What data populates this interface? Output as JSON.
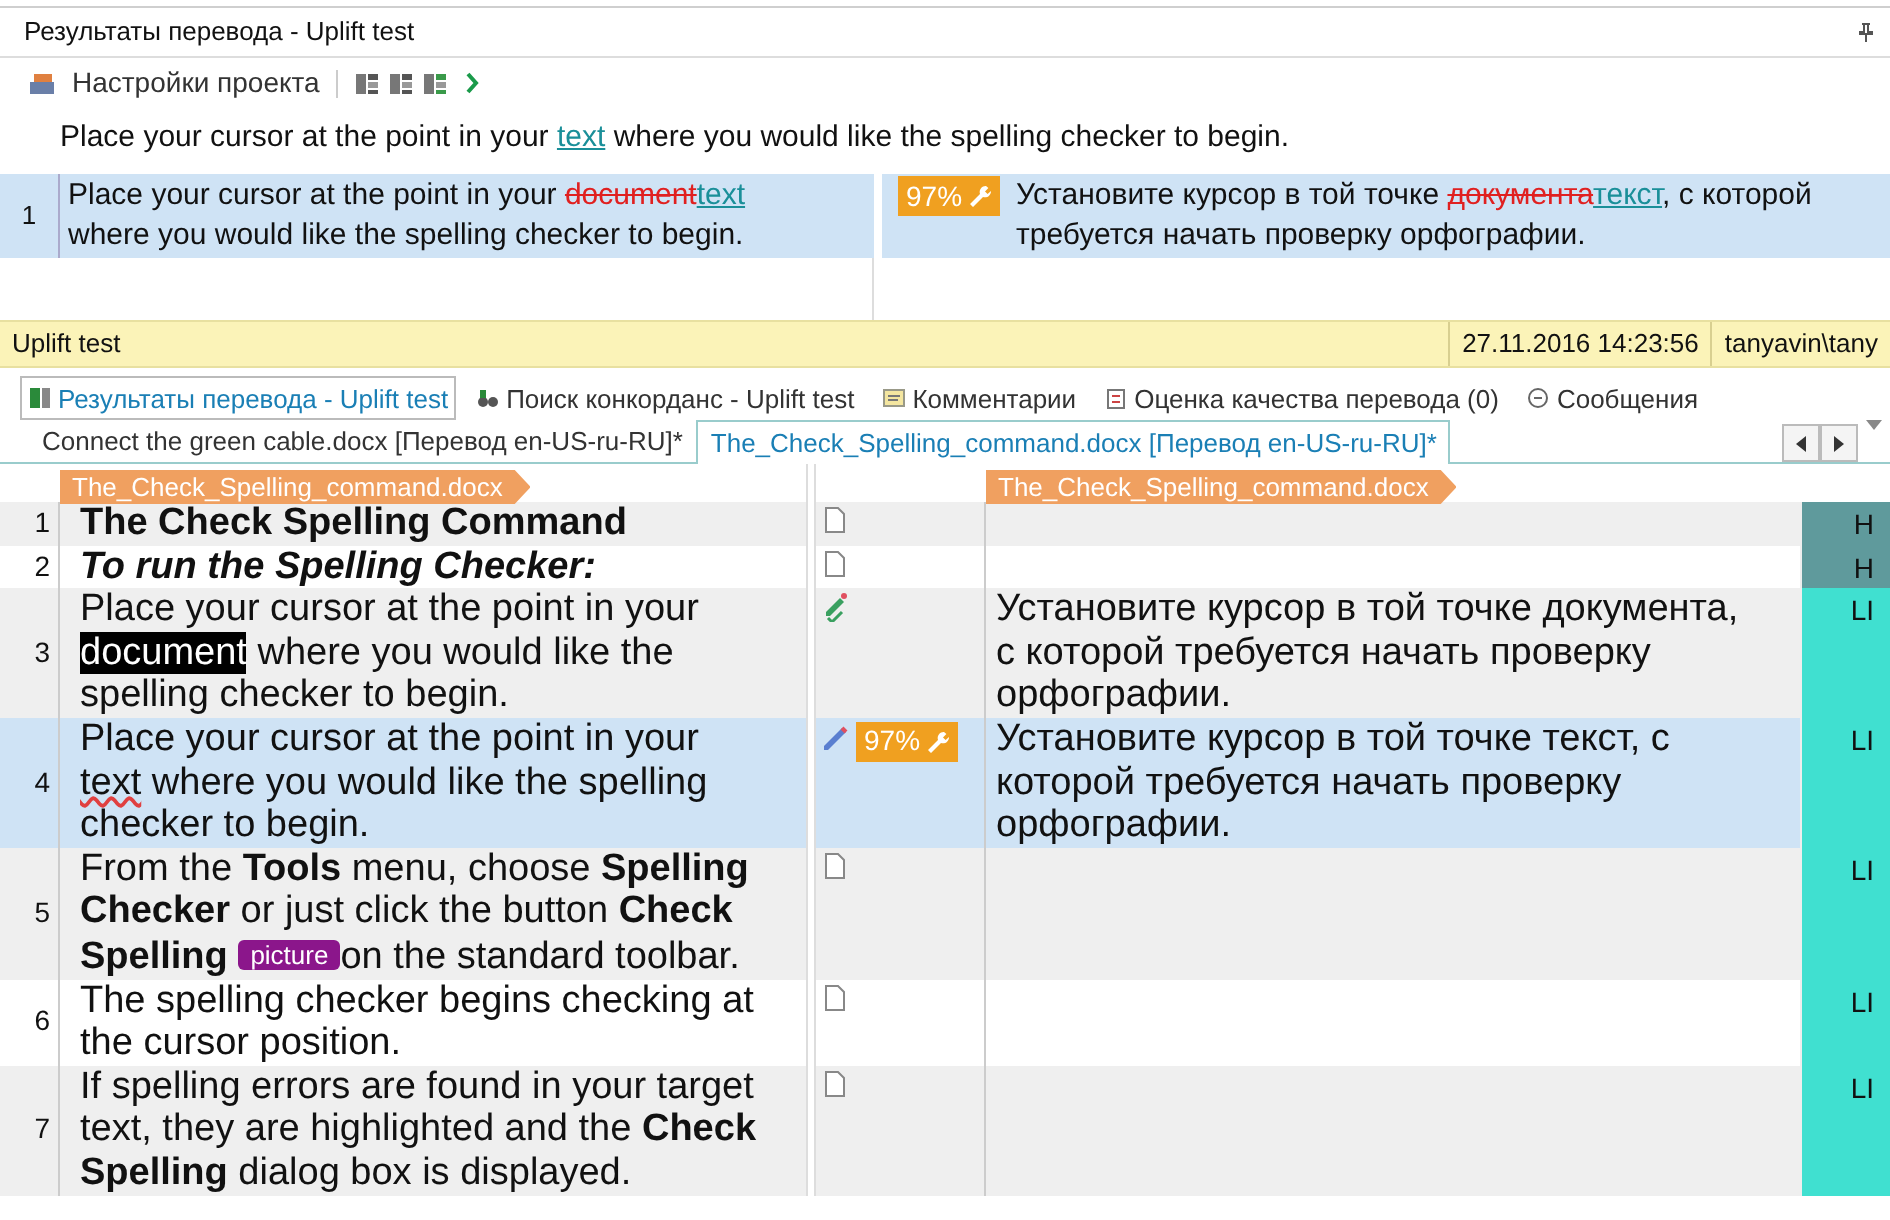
{
  "panel": {
    "title": "Результаты перевода - Uplift test"
  },
  "toolbar": {
    "settings_label": "Настройки проекта"
  },
  "preview": [
    {
      "kind": "plain",
      "text": "Place your cursor at the point in your "
    },
    {
      "kind": "inserted",
      "text": "text"
    },
    {
      "kind": "plain",
      "text": " where you would like the spelling checker to begin."
    }
  ],
  "match": {
    "number": "1",
    "score": "97%",
    "source": [
      {
        "kind": "plain",
        "text": "Place your cursor at the point in your "
      },
      {
        "kind": "deleted",
        "text": "document"
      },
      {
        "kind": "inserted",
        "text": "text"
      },
      {
        "kind": "plain",
        "text": " where you would like the spelling checker to begin."
      }
    ],
    "target": [
      {
        "kind": "plain",
        "text": "Установите курсор в той точке "
      },
      {
        "kind": "deleted",
        "text": "документа"
      },
      {
        "kind": "inserted",
        "text": "текст"
      },
      {
        "kind": "plain",
        "text": ", с которой требуется начать проверку орфографии."
      }
    ]
  },
  "status_bar": {
    "project": "Uplift test",
    "date": "27.11.2016 14:23:56",
    "user": "tanyavin\\tany"
  },
  "panel_tabs": [
    {
      "label": "Результаты перевода - Uplift test",
      "selected": true
    },
    {
      "label": "Поиск конкорданс - Uplift test",
      "selected": false
    },
    {
      "label": "Комментарии",
      "selected": false
    },
    {
      "label": "Оценка качества перевода (0)",
      "selected": false
    },
    {
      "label": "Сообщения",
      "selected": false
    }
  ],
  "document_tabs": [
    {
      "label": "Connect the green cable.docx [Перевод en-US-ru-RU]*",
      "selected": false
    },
    {
      "label": "The_Check_Spelling_command.docx [Перевод en-US-ru-RU]*",
      "selected": true
    }
  ],
  "source_file_tag": "The_Check_Spelling_command.docx",
  "target_file_tag": "The_Check_Spelling_command.docx",
  "rows": [
    {
      "number": "1",
      "bold": true,
      "italic": false,
      "kind": "empty",
      "selected": false,
      "style": "H",
      "color": "#5f9a9c",
      "source": [
        {
          "kind": "plain",
          "text": "The Check Spelling Command"
        }
      ]
    },
    {
      "number": "2",
      "bold": true,
      "italic": true,
      "kind": "empty",
      "selected": false,
      "style": "H",
      "color": "#5f9a9c",
      "source": [
        {
          "kind": "plain",
          "text": "To run the Spelling Checker:"
        }
      ]
    },
    {
      "number": "3",
      "bold": false,
      "italic": false,
      "kind": "translated",
      "selected": false,
      "style": "LI",
      "color": "#40e0d0",
      "source": [
        {
          "kind": "plain",
          "text": "Place your cursor at the point in your "
        },
        {
          "kind": "highlight",
          "text": "document"
        },
        {
          "kind": "plain",
          "text": " where you would like the spelling checker to begin."
        }
      ],
      "target": "Установите курсор в той точке документа, с которой требуется начать проверку орфографии."
    },
    {
      "number": "4",
      "bold": false,
      "italic": false,
      "kind": "edited",
      "selected": true,
      "score": "97%",
      "style": "LI",
      "color": "#40e0d0",
      "source": [
        {
          "kind": "plain",
          "text": "Place your cursor at the point in your "
        },
        {
          "kind": "misspelled",
          "text": "text"
        },
        {
          "kind": "plain",
          "text": " where you would like the spelling checker to begin."
        }
      ],
      "target": "Установите курсор в той точке текст, с которой требуется начать проверку орфографии."
    },
    {
      "number": "5",
      "bold": false,
      "italic": false,
      "kind": "empty",
      "selected": false,
      "style": "LI",
      "color": "#40e0d0",
      "source": [
        {
          "kind": "plain",
          "text": "From the **Tools** menu, choose **Spelling Checker** or just click the button **Check Spelling** "
        },
        {
          "kind": "tag",
          "text": "picture"
        },
        {
          "kind": "plain",
          "text": "on the standard toolbar."
        }
      ]
    },
    {
      "number": "6",
      "bold": false,
      "italic": false,
      "kind": "empty",
      "selected": false,
      "style": "LI",
      "color": "#40e0d0",
      "source": [
        {
          "kind": "plain",
          "text": "The spelling checker begins checking at the cursor position."
        }
      ]
    },
    {
      "number": "7",
      "bold": false,
      "italic": false,
      "kind": "empty",
      "selected": false,
      "style": "LI",
      "color": "#40e0d0",
      "source": [
        {
          "kind": "plain",
          "text": "If spelling errors are found in your target text, they are highlighted and the **Check Spelling** dialog box is displayed."
        }
      ]
    }
  ]
}
